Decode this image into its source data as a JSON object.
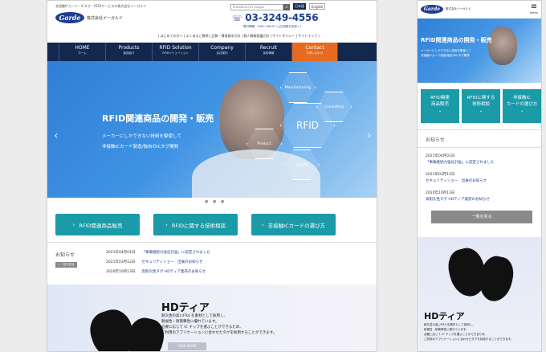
{
  "desktop": {
    "tagline": "非接触ICカード・ICタグ・RFIDサービスの株式会社イーガルド",
    "logo_mark": "Garde",
    "logo_sub": "株式会社イーガルド",
    "search_placeholder": "ENHANCED BY Google",
    "lang_ja": "日本語",
    "lang_en": "English",
    "phone": "03-3249-4556",
    "phone_hours": "受付時間：9:00〜18:00（土日祝祭日を除く）",
    "utility": "| はじめての方へ | よくあるご質問 | 品質・環境基本方針 | 個人情報保護方針 | サイトポリシー | サイトマップ |",
    "nav": [
      {
        "en": "HOME",
        "ja": "ホーム"
      },
      {
        "en": "Products",
        "ja": "製品紹介"
      },
      {
        "en": "RFID Solution",
        "ja": "RFIDソリューション"
      },
      {
        "en": "Company",
        "ja": "会社案内"
      },
      {
        "en": "Recruit",
        "ja": "採用情報"
      },
      {
        "en": "Contact",
        "ja": "お問い合わせ"
      }
    ],
    "hero": {
      "title": "RFID関連商品の開発・販売",
      "sub1": "メーカーにしかできない技術を駆使して",
      "sub2": "非接触ICカード製造/独自のICタグ開発",
      "hex": [
        "Manufacturing",
        "Consulting",
        "RFID",
        "Product",
        "Quality"
      ],
      "prev": "‹",
      "next": "›",
      "dots": "● ● ●"
    },
    "cta": [
      "RFID関連商品販売",
      "RFIDに関する技術相談",
      "非接触ICカードの選び方"
    ],
    "news": {
      "heading": "お知らせ",
      "list_button": "» 一覧を見る",
      "items": [
        {
          "date": "2021年04月01日",
          "title": "「事業継続力強化計画」に認定されました"
        },
        {
          "date": "2021年03月12日",
          "title": "セキュリティショー　出展のお知らせ"
        },
        {
          "date": "2020年10月13日",
          "title": "高耐久性タグ HDティア発売のお知らせ"
        }
      ]
    },
    "feature": {
      "title": "HDティア",
      "lines": [
        "耐久性の高いFR4 を素材として採用し、",
        "耐候性・耐衝撃性に優れています。",
        "必要に応じて IC チップを選ぶことができるため、",
        "ご利用のアプリケーションに合わせたタグを採用することができます。"
      ],
      "view_more": "VIEW MORE"
    }
  },
  "mobile": {
    "logo_mark": "Garde",
    "logo_sub": "株式会社イーガルド",
    "menu": "menu",
    "hero": {
      "title": "RFID関連商品の開発・販売",
      "sub1": "メーカーにしかできない技術を駆使して",
      "sub2": "非接触ICカード製造/独自のICタグ開発",
      "dots": "● ● ●"
    },
    "cta": [
      {
        "l1": "RFID関連",
        "l2": "商品販売"
      },
      {
        "l1": "RFIDに関する",
        "l2": "技術相談"
      },
      {
        "l1": "非接触IC",
        "l2": "カードの選び方"
      }
    ],
    "chev": "⌄",
    "news": {
      "heading": "お知らせ",
      "items": [
        {
          "date": "2021年04月01日",
          "title": "「事業継続力強化計画」に認定されました"
        },
        {
          "date": "2021年03月12日",
          "title": "セキュリティショー　出展のお知らせ"
        },
        {
          "date": "2020年10月13日",
          "title": "高耐久性タグ HDティア発売のお知らせ"
        }
      ],
      "list_button": "一覧を見る"
    },
    "feature": {
      "title": "HDティア",
      "lines": [
        "耐久性の高いFR4 を素材として採用し、",
        "耐候性・耐衝撃性に優れています。",
        "必要に応じて IC チップを選ぶことができるため、",
        "ご利用のアプリケーションに合わせたタグを採用することができます。"
      ]
    }
  },
  "colors": {
    "navy": "#13284f",
    "brand": "#1d3d8f",
    "teal": "#1b9aa8",
    "orange": "#e66a1f"
  }
}
